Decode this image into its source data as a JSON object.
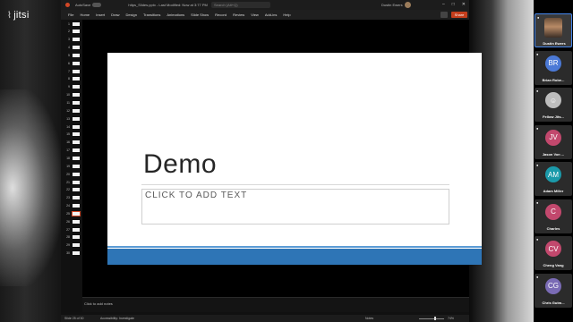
{
  "jitsi": {
    "logo_text": "jitsi",
    "participants": [
      {
        "name": "Dustin Ewers",
        "initials": "",
        "color": "#3a3a3a",
        "is_self": true
      },
      {
        "name": "Brian Robe...",
        "initials": "BR",
        "color": "#4b79d6"
      },
      {
        "name": "Fellow Jits...",
        "initials": "",
        "color": "#bdbdbd"
      },
      {
        "name": "Jason Von ...",
        "initials": "JV",
        "color": "#c2486d"
      },
      {
        "name": "Adam Miller",
        "initials": "AM",
        "color": "#1b9aaa"
      },
      {
        "name": "Charles",
        "initials": "C",
        "color": "#c2486d"
      },
      {
        "name": "Cheng Vang",
        "initials": "CV",
        "color": "#c2486d"
      },
      {
        "name": "Chris Gutm...",
        "initials": "CG",
        "color": "#7a6bb5"
      }
    ]
  },
  "ppt": {
    "titlebar": {
      "autosave": "AutoSave",
      "filename": "https_Slides.pptx - Last Modified: Now at 3:77 PM",
      "search_placeholder": "Search (Alt+Q)",
      "user": "Dustin Ewers"
    },
    "ribbon_tabs": [
      "File",
      "Home",
      "Insert",
      "Draw",
      "Design",
      "Transitions",
      "Animations",
      "Slide Show",
      "Record",
      "Review",
      "View",
      "Add-ins",
      "Help"
    ],
    "share_label": "Share",
    "thumbnails": [
      "1",
      "2",
      "3",
      "4",
      "5",
      "6",
      "7",
      "8",
      "9",
      "10",
      "11",
      "12",
      "13",
      "14",
      "15",
      "16",
      "17",
      "18",
      "19",
      "20",
      "21",
      "22",
      "23",
      "24",
      "25",
      "26",
      "27",
      "28",
      "29",
      "30"
    ],
    "active_thumbnail": "25",
    "slide": {
      "title": "Demo",
      "placeholder": "CLICK TO ADD TEXT",
      "accent_color": "#2e75b6"
    },
    "notes_placeholder": "Click to add notes",
    "status": {
      "slide_info": "Slide 25 of 30",
      "accessibility": "Accessibility: Investigate",
      "notes_label": "Notes",
      "zoom": "74%"
    }
  }
}
